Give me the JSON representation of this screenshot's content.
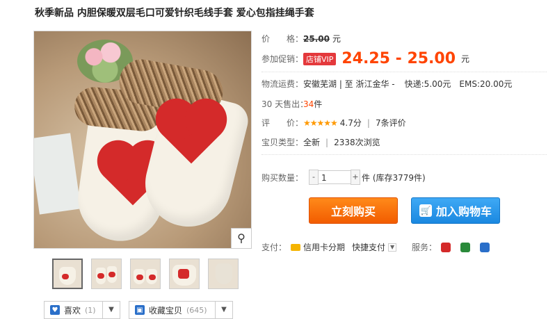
{
  "product": {
    "title": "秋季新品 内胆保暖双层毛口可爱针织毛线手套 爱心包指挂绳手套"
  },
  "price": {
    "label": "价　　格：",
    "value": "25.00",
    "unit": "元"
  },
  "promo": {
    "label": "参加促销：",
    "badge": "店铺VIP",
    "range": "24.25 - 25.00",
    "unit": "元"
  },
  "shipping": {
    "label": "物流运费：",
    "route": "安徽芜湖 | 至  浙江金华 -",
    "express": "快递:5.00元",
    "ems": "EMS:20.00元"
  },
  "sold": {
    "label": "30 天售出：",
    "count": "34",
    "unit": "件"
  },
  "rating": {
    "label": "评　　价：",
    "stars": "★★★★★",
    "score": "4.7分",
    "divider": "|",
    "reviews": "7条评价"
  },
  "item_type": {
    "label": "宝贝类型：",
    "condition": "全新",
    "divider": "|",
    "views": "2338次浏览"
  },
  "quantity": {
    "label": "购买数量：",
    "minus": "-",
    "value": "1",
    "plus": "+",
    "stock": "件 (库存3779件)"
  },
  "buttons": {
    "buy_now": "立刻购买",
    "add_cart": "加入购物车"
  },
  "payment": {
    "label": "支付：",
    "credit": "信用卡分期",
    "quick": "快捷支付",
    "service_label": "服务："
  },
  "actions": {
    "like": {
      "label": "喜欢",
      "count": "(1)"
    },
    "favorite": {
      "label": "收藏宝贝",
      "count": "(645)"
    }
  },
  "icons": [
    "magnifier-icon",
    "heart-icon",
    "favorite-icon",
    "dropdown-arrow-icon",
    "cart-icon",
    "credit-card-icon"
  ],
  "colors": {
    "price_orange": "#ff4400",
    "vip_badge": "#e4393c",
    "buy_button": "#f25c00",
    "cart_button": "#1a88e0"
  }
}
